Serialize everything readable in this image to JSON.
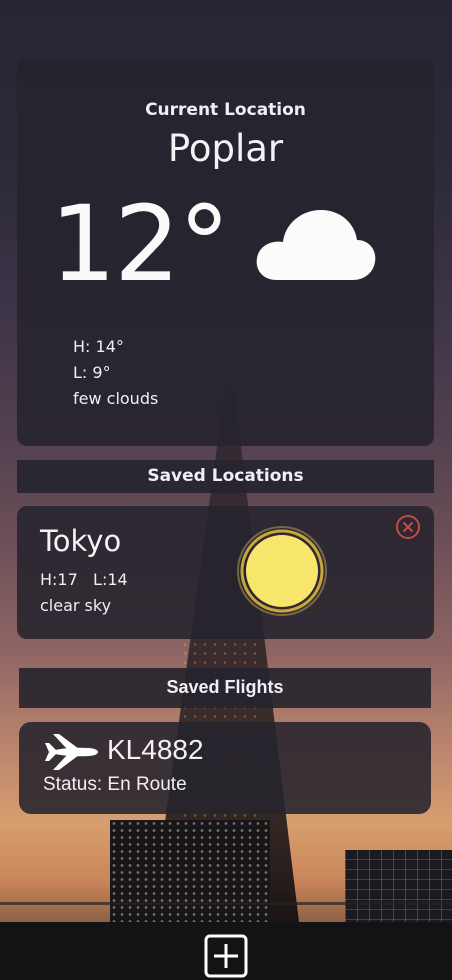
{
  "current": {
    "heading": "Current Location",
    "city": "Poplar",
    "temperature": "12°",
    "high": "H: 14°",
    "low": "L: 9°",
    "description": "few clouds",
    "icon": "cloud-icon"
  },
  "saved_locations": {
    "header": "Saved Locations",
    "items": [
      {
        "city": "Tokyo",
        "hilo": "H:17   L:14",
        "description": "clear sky",
        "icon": "sun-icon",
        "remove_icon": "close-circle-icon"
      }
    ]
  },
  "saved_flights": {
    "header": "Saved Flights",
    "items": [
      {
        "flight_number": "KL4882",
        "status": "Status: En Route",
        "icon": "airplane-icon"
      }
    ]
  },
  "bottom_bar": {
    "add_icon": "add-square-icon"
  },
  "colors": {
    "sun_fill": "#f7e56c",
    "remove_icon": "#c44a4a",
    "card_bg": "#26232d"
  }
}
